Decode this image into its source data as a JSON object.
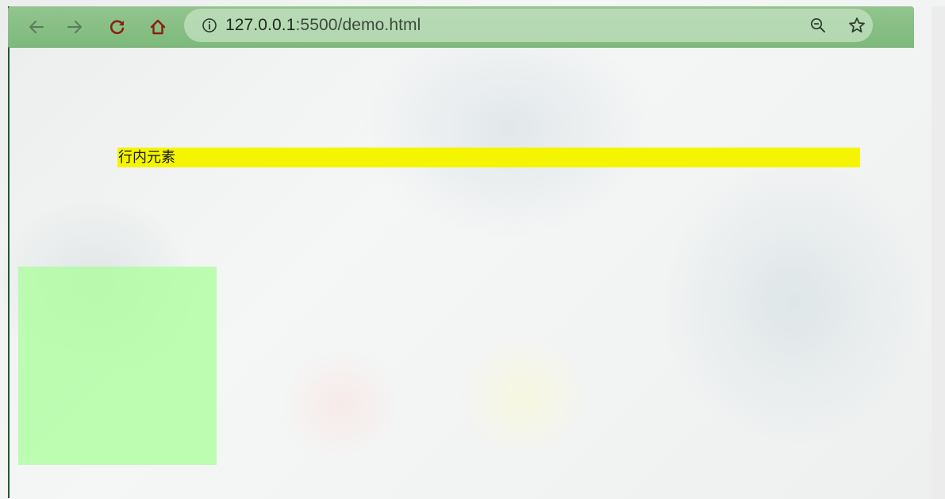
{
  "browser": {
    "url_host": "127.0.0.1",
    "url_path": ":5500/demo.html",
    "icons": {
      "back": "arrow-left-icon",
      "forward": "arrow-right-icon",
      "reload": "reload-icon",
      "home": "home-icon",
      "info": "info-icon",
      "zoom": "zoom-out-icon",
      "bookmark": "star-icon"
    },
    "colors": {
      "toolbar": "#7dba7b",
      "omnibox": "#c4e2c2",
      "reload_home_icons": "#8b1f10"
    }
  },
  "page": {
    "inline_element_text": "行内元素",
    "colors": {
      "inline_element_bg": "#f5f500",
      "block_bg": "#aaff9b"
    }
  }
}
